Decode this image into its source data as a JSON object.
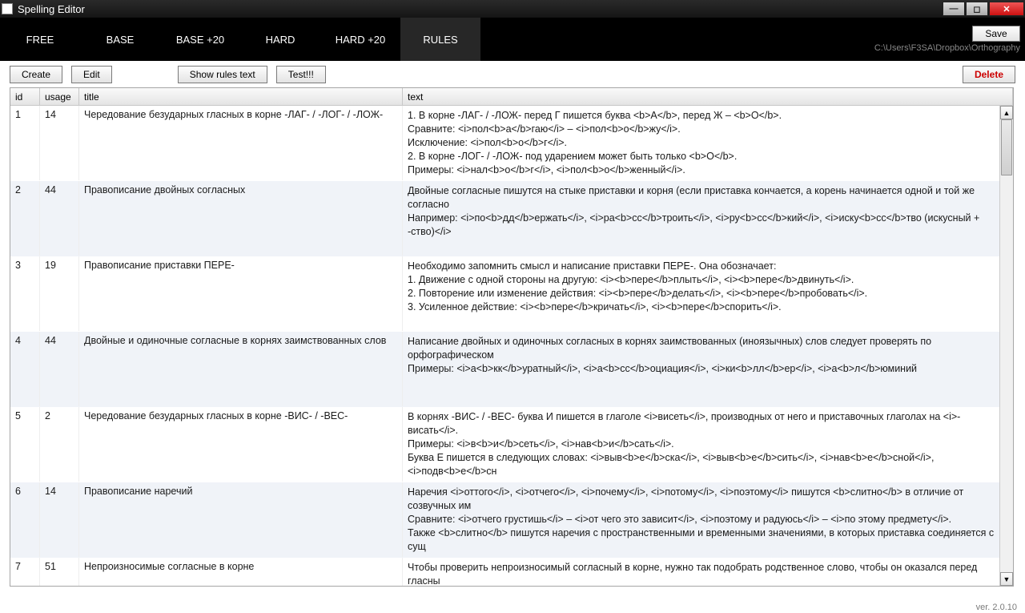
{
  "window": {
    "title": "Spelling Editor"
  },
  "tabs": {
    "items": [
      {
        "label": "FREE"
      },
      {
        "label": "BASE"
      },
      {
        "label": "BASE +20"
      },
      {
        "label": "HARD"
      },
      {
        "label": "HARD +20"
      },
      {
        "label": "RULES"
      }
    ],
    "active": 5
  },
  "save_label": "Save",
  "file_path": "C:\\Users\\F3SA\\Dropbox\\Orthography",
  "toolbar": {
    "create": "Create",
    "edit": "Edit",
    "show_rules": "Show rules text",
    "test": "Test!!!",
    "delete": "Delete"
  },
  "columns": {
    "id": "id",
    "usage": "usage",
    "title": "title",
    "text": "text"
  },
  "rows": [
    {
      "id": "1",
      "usage": "14",
      "title": "Чередование безударных гласных в корне -ЛАГ- / -ЛОГ- / -ЛОЖ-",
      "text": "1. В корне -ЛАГ- / -ЛОЖ- перед Г пишется буква <b>А</b>, перед Ж – <b>О</b>.\nСравните: <i>пол<b>а</b>гаю</i> – <i>пол<b>о</b>жу</i>.\nИсключение: <i>пол<b>о</b>г</i>.\n2. В корне -ЛОГ- / -ЛОЖ- под ударением может быть только <b>О</b>.\nПримеры: <i>нал<b>о</b>г</i>, <i>пол<b>о</b>женный</i>."
    },
    {
      "id": "2",
      "usage": "44",
      "title": "Правописание двойных согласных",
      "text": "Двойные согласные пишутся на стыке приставки и корня (если приставка кончается, а корень начинается одной и той же согласно\nНапример: <i>по<b>дд</b>ержать</i>, <i>ра<b>сс</b>троить</i>, <i>ру<b>сс</b>кий</i>, <i>иску<b>сс</b>тво (искусный + -ство)</i>"
    },
    {
      "id": "3",
      "usage": "19",
      "title": "Правописание приставки ПЕРЕ-",
      "text": "Необходимо запомнить смысл и написание приставки ПЕРЕ-. Она обозначает:\n1. Движение с одной стороны на другую: <i><b>пере</b>плыть</i>, <i><b>пере</b>двинуть</i>.\n2. Повторение или изменение действия: <i><b>пере</b>делать</i>, <i><b>пере</b>пробовать</i>.\n3. Усиленное действие: <i><b>пере</b>кричать</i>, <i><b>пере</b>спорить</i>."
    },
    {
      "id": "4",
      "usage": "44",
      "title": "Двойные и одиночные согласные в корнях заимствованных слов",
      "text": "Написание двойных и одиночных согласных в корнях заимствованных (иноязычных) слов следует проверять по орфографическом\nПримеры: <i>а<b>кк</b>уратный</i>, <i>а<b>сс</b>оциация</i>, <i>ки<b>лл</b>ер</i>, <i>а<b>л</b>юминий"
    },
    {
      "id": "5",
      "usage": "2",
      "title": "Чередование безударных гласных в корне -ВИС- / -ВЕС-",
      "text": "В корнях -ВИС- / -ВЕС- буква И пишется в глаголе <i>висеть</i>, производных от него и приставочных глаголах на <i>-висать</i>.\nПримеры: <i>в<b>и</b>сеть</i>, <i>нав<b>и</b>сать</i>.\nБуква Е пишется в следующих словах: <i>выв<b>е</b>ска</i>, <i>выв<b>е</b>сить</i>, <i>нав<b>е</b>сной</i>, <i>подв<b>е</b>сн"
    },
    {
      "id": "6",
      "usage": "14",
      "title": "Правописание наречий",
      "text": "Наречия <i>оттого</i>, <i>отчего</i>, <i>почему</i>, <i>потому</i>, <i>поэтому</i> пишутся <b>слитно</b> в отличие от созвучных им\nСравните: <i>отчего грустишь</i> – <i>от чего это зависит</i>, <i>поэтому и радуюсь</i> – <i>по этому предмету</i>.\nТакже <b>слитно</b> пишутся наречия с пространственными и временными значениями, в которых приставка соединяется с сущ"
    },
    {
      "id": "7",
      "usage": "51",
      "title": "Непроизносимые согласные в корне",
      "text": "Чтобы проверить непроизносимый согласный в корне, нужно так подобрать родственное слово, чтобы он оказался перед гласны\nПримеры: <i>здра<b>в</b>ствовать (здра<b>в</b>ие)</i>, <i>аген<b>т</b>ство (аген<b>т</b>ы)</i>, <i>свис<b>т</b>нуть (свис<b>т"
    }
  ],
  "version": "ver. 2.0.10"
}
